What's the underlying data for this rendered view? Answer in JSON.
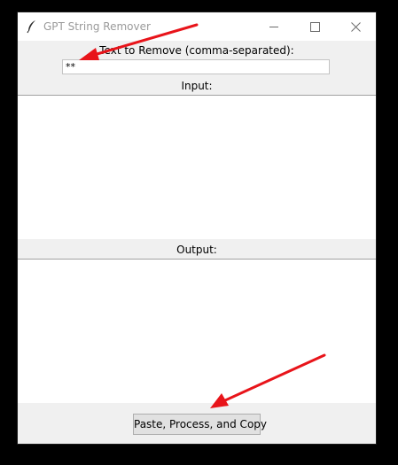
{
  "window": {
    "title": "GPT String Remover"
  },
  "remove": {
    "label": "Text to Remove (comma-separated):",
    "value": "**"
  },
  "input": {
    "label": "Input:",
    "value": ""
  },
  "output": {
    "label": "Output:",
    "value": ""
  },
  "actions": {
    "process_label": "Paste, Process, and Copy"
  },
  "icons": {
    "app": "feather-icon",
    "minimize": "minimize-icon",
    "maximize": "maximize-icon",
    "close": "close-icon"
  },
  "colors": {
    "annotation_arrow": "#e8141a",
    "window_bg": "#f0f0f0",
    "title_text": "#9a9a9a"
  }
}
